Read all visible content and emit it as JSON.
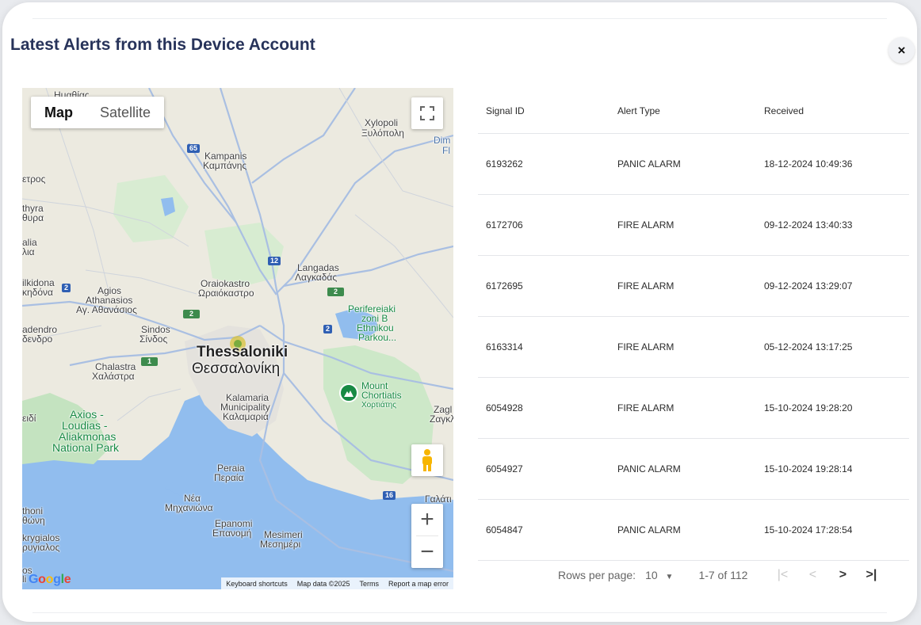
{
  "dialog": {
    "title": "Latest Alerts from this Device Account",
    "close_label": "×"
  },
  "map": {
    "tabs": [
      {
        "label": "Map",
        "active": true
      },
      {
        "label": "Satellite",
        "active": false
      }
    ],
    "fullscreen_icon": "fullscreen-icon",
    "pegman_icon": "street-view-pegman-icon",
    "zoom_in_label": "+",
    "zoom_out_label": "−",
    "google_logo": "Google",
    "footer": {
      "shortcuts": "Keyboard shortcuts",
      "data": "Map data ©2025",
      "terms": "Terms",
      "report": "Report a map error"
    },
    "labels": {
      "top_left": "Ημαθίας",
      "xylopoli": "Xylopoli",
      "xylopoli_gr": "Ξυλόπολη",
      "dim": "Dim",
      "fl": "Fl",
      "kampanis": "Kampanis",
      "kampanis_gr": "Καμπάνης",
      "etros": "ετρος",
      "thyra": "thyra",
      "thyra_gr": "θυρα",
      "alia": "alia",
      "alia_gr": "λια",
      "langadas": "Langadas",
      "langadas_gr": "Λαγκαδάς",
      "ilkidona": "ilkidona",
      "ilkidona_gr": "κηδόνα",
      "agios": "Agios",
      "athanasios": "Athanasios",
      "athanasios_gr": "Αγ. Αθανάσιος",
      "oraiokastro": "Oraiokastro",
      "oraiokastro_gr": "Ωραιόκαστρο",
      "perif1": "Perifereiaki",
      "perif2": "zoni B",
      "perif3": "Ethnikou",
      "perif4": "Parkou...",
      "adendro": "adendro",
      "adendro_gr": "δενδρο",
      "sindos": "Sindos",
      "sindos_gr": "Σίνδος",
      "thessaloniki": "Thessaloniki",
      "thessaloniki_gr": "Θεσσαλονίκη",
      "chalastra": "Chalastra",
      "chalastra_gr": "Χαλάστρα",
      "mount1": "Mount",
      "mount2": "Chortiatis",
      "mount_gr": "Χορτιάτης",
      "zagl": "Zagl",
      "zagl_gr": "Ζαγκλ",
      "kalamaria1": "Kalamaria",
      "kalamaria2": "Municipality",
      "kalamaria_gr": "Καλαμαριά",
      "eidi": "ειδί",
      "axios1": "Axios -",
      "axios2": "Loudias -",
      "axios3": "Aliakmonas",
      "axios4": "National Park",
      "peraia": "Peraia",
      "peraia_gr": "Περαία",
      "nea": "Νέα",
      "michaniona": "Μηχανιώνα",
      "galati": "Γαλάτι",
      "thoni": "thoni",
      "thoni_gr": "θώνη",
      "epanomi": "Epanomi",
      "epanomi_gr": "Επανομή",
      "mesimeri": "Mesimeri",
      "mesimeri_gr": "Μεσημέρι",
      "krygialos": "krygialos",
      "krygialos_gr": "ρυγιαλος",
      "os": "os",
      "li": "li"
    },
    "shields": {
      "s65": "65",
      "s12": "12",
      "s2a": "2",
      "s2b": "2",
      "s2c": "2",
      "s2d": "2",
      "s1": "1",
      "s16": "16"
    }
  },
  "table": {
    "columns": [
      "Signal ID",
      "Alert Type",
      "Received"
    ],
    "rows": [
      {
        "signal_id": "6193262",
        "alert_type": "PANIC ALARM",
        "received": "18-12-2024 10:49:36"
      },
      {
        "signal_id": "6172706",
        "alert_type": "FIRE ALARM",
        "received": "09-12-2024 13:40:33"
      },
      {
        "signal_id": "6172695",
        "alert_type": "FIRE ALARM",
        "received": "09-12-2024 13:29:07"
      },
      {
        "signal_id": "6163314",
        "alert_type": "FIRE ALARM",
        "received": "05-12-2024 13:17:25"
      },
      {
        "signal_id": "6054928",
        "alert_type": "FIRE ALARM",
        "received": "15-10-2024 19:28:20"
      },
      {
        "signal_id": "6054927",
        "alert_type": "PANIC ALARM",
        "received": "15-10-2024 19:28:14"
      },
      {
        "signal_id": "6054847",
        "alert_type": "PANIC ALARM",
        "received": "15-10-2024 17:28:54"
      }
    ]
  },
  "pagination": {
    "rows_per_page_label": "Rows per page:",
    "rows_per_page_value": "10",
    "range": "1-7 of 112",
    "first_icon": "first-page-icon",
    "prev_icon": "chevron-left-icon",
    "next_icon": "chevron-right-icon",
    "last_icon": "last-page-icon"
  }
}
